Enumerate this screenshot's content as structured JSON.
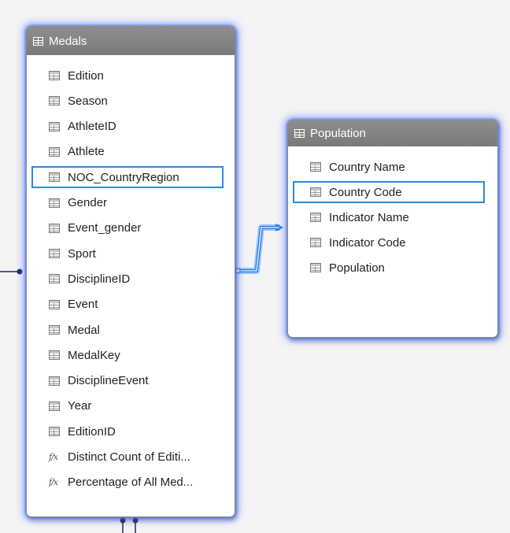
{
  "medals_table": {
    "title": "Medals",
    "fields": [
      {
        "label": "Edition",
        "icon": "column-icon"
      },
      {
        "label": "Season",
        "icon": "column-icon"
      },
      {
        "label": "AthleteID",
        "icon": "column-icon"
      },
      {
        "label": "Athlete",
        "icon": "column-icon"
      },
      {
        "label": "NOC_CountryRegion",
        "icon": "column-icon",
        "selected": true
      },
      {
        "label": "Gender",
        "icon": "column-icon"
      },
      {
        "label": "Event_gender",
        "icon": "column-icon"
      },
      {
        "label": "Sport",
        "icon": "column-icon"
      },
      {
        "label": "DisciplineID",
        "icon": "column-icon"
      },
      {
        "label": "Event",
        "icon": "column-icon"
      },
      {
        "label": "Medal",
        "icon": "column-icon"
      },
      {
        "label": "MedalKey",
        "icon": "column-icon"
      },
      {
        "label": "DisciplineEvent",
        "icon": "column-icon"
      },
      {
        "label": "Year",
        "icon": "column-icon"
      },
      {
        "label": "EditionID",
        "icon": "column-icon"
      },
      {
        "label": "Distinct Count of Editi...",
        "icon": "measure-icon"
      },
      {
        "label": "Percentage of All Med...",
        "icon": "measure-icon"
      }
    ],
    "measure_icon_glyph": "f/x"
  },
  "population_table": {
    "title": "Population",
    "fields": [
      {
        "label": "Country Name",
        "icon": "column-icon"
      },
      {
        "label": "Country Code",
        "icon": "column-icon",
        "selected": true
      },
      {
        "label": "Indicator Name",
        "icon": "column-icon"
      },
      {
        "label": "Indicator Code",
        "icon": "column-icon"
      },
      {
        "label": "Population",
        "icon": "column-icon"
      }
    ]
  },
  "colors": {
    "header_bg": "#808080",
    "selection_border": "#2a8ae0",
    "relationship_line": "#2a7ae8",
    "connector_dark": "#1a2a55",
    "glow": "#5078ff"
  }
}
